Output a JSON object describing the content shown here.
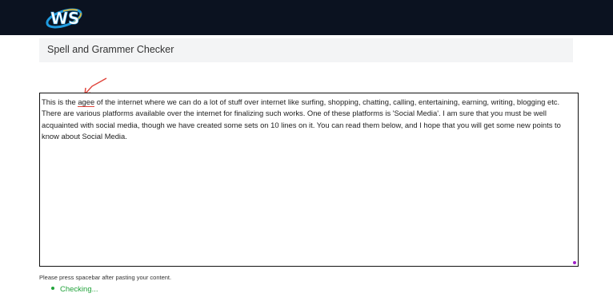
{
  "header": {
    "logo_text": "WS",
    "brand_color": "#0b1220"
  },
  "page": {
    "title": "Spell and Grammer Checker"
  },
  "editor": {
    "text_before_error": "This is the ",
    "error_word": "agee",
    "text_after_error": " of the internet where we can do a lot of stuff over internet like surfing, shopping, chatting, calling, entertaining, earning, writing, blogging etc. There are various platforms available over the internet for finalizing such works. One of these platforms is 'Social Media'. I am sure that you must be well acquainted with social media, though we have created some sets on 10 lines on it. You can read them below, and I hope that you will get some new points to know about Social Media.",
    "error_color": "#e0433a"
  },
  "footer": {
    "hint": "Please press spacebar after pasting your content.",
    "status": "Checking...",
    "status_color": "#22a33b"
  }
}
